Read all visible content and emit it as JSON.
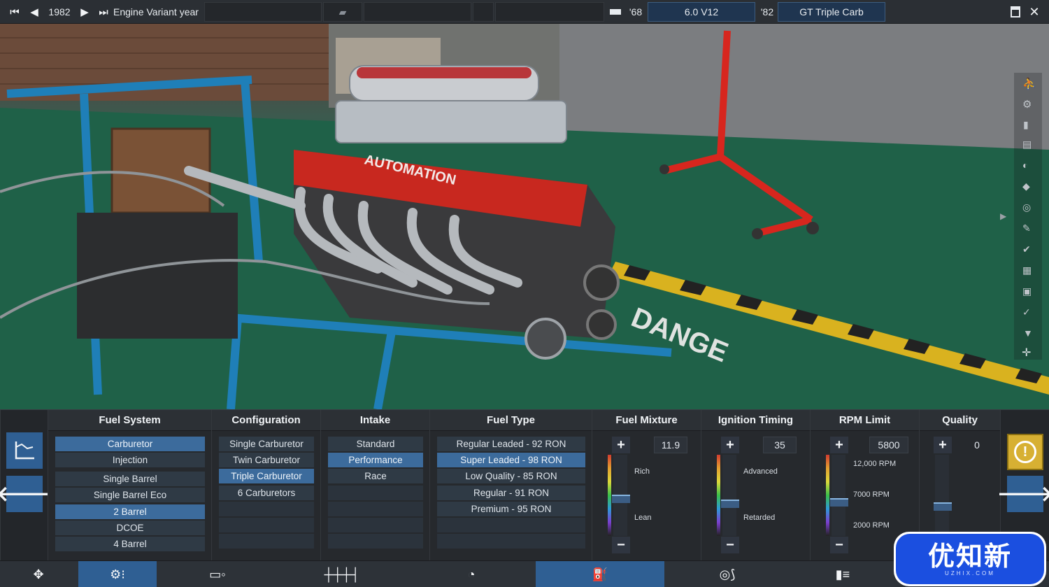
{
  "topbar": {
    "year": "1982",
    "variant_label": "Engine Variant year",
    "family_year": "'68",
    "family_name": "6.0 V12",
    "variant_year": "'82",
    "variant_name": "GT Triple Carb"
  },
  "viewport": {
    "logo_text": "AUTOMATION",
    "floor_text": "DANGE"
  },
  "panel": {
    "fuel_system": {
      "title": "Fuel System",
      "types": [
        "Carburetor",
        "Injection"
      ],
      "options": [
        "Single Barrel",
        "Single Barrel Eco",
        "2 Barrel",
        "DCOE",
        "4 Barrel"
      ],
      "selected_type": "Carburetor",
      "selected_option": "2 Barrel"
    },
    "configuration": {
      "title": "Configuration",
      "options": [
        "Single Carburetor",
        "Twin Carburetor",
        "Triple Carburetor",
        "6 Carburetors"
      ],
      "selected": "Triple Carburetor"
    },
    "intake": {
      "title": "Intake",
      "options": [
        "Standard",
        "Performance",
        "Race"
      ],
      "selected": "Performance"
    },
    "fuel_type": {
      "title": "Fuel Type",
      "options": [
        "Regular Leaded -  92 RON",
        "Super Leaded -  98 RON",
        "Low Quality - 85 RON",
        "Regular - 91 RON",
        "Premium - 95 RON"
      ],
      "selected": "Super Leaded -  98 RON"
    },
    "fuel_mixture": {
      "title": "Fuel Mixture",
      "value": "11.9",
      "label_top": "Rich",
      "label_bottom": "Lean",
      "level": 0.45
    },
    "ignition_timing": {
      "title": "Ignition Timing",
      "value": "35",
      "label_top": "Advanced",
      "label_bottom": "Retarded",
      "level": 0.38
    },
    "rpm_limit": {
      "title": "RPM Limit",
      "value": "5800",
      "label_top": "12,000 RPM",
      "label_mid": "7000 RPM",
      "label_bottom": "2000 RPM",
      "level": 0.4
    },
    "quality": {
      "title": "Quality",
      "value": "0",
      "level": 0.5
    }
  },
  "icons": {
    "accent": "#3c6b9c",
    "warning": "#d7b033",
    "watermark_text": "优知新",
    "watermark_sub": "UZHIX.COM"
  }
}
